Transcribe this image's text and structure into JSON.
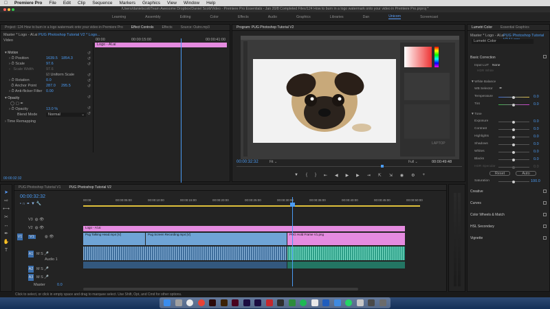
{
  "menubar": {
    "apple": "",
    "items": [
      "Premiere Pro",
      "File",
      "Edit",
      "Clip",
      "Sequence",
      "Markers",
      "Graphics",
      "View",
      "Window",
      "Help"
    ]
  },
  "titlebar": {
    "path": "/Users/danielscott/Team Awesome Dropbox/Daniel Scott/Video - Premiere Pro Essentials - Jan 20/8 Completed Files/124 How to burn in a logo watermark onto your video in Premiere Pro.prproj *"
  },
  "workspaces": {
    "items": [
      "Learning",
      "Assembly",
      "Editing",
      "Color",
      "Effects",
      "Audio",
      "Graphics",
      "Libraries",
      "Dan",
      "Unicorn",
      "Screencast"
    ],
    "active": "Unicorn"
  },
  "project_panel": {
    "title": "Project: 124 How to burn in a logo watermark onto your video in Premiere Pro"
  },
  "effect_controls": {
    "tabs": [
      "Effect Controls",
      "Effects",
      "Source: Outro.mp3"
    ],
    "active_tab": "Effect Controls",
    "master": "Master * Logo - Al.ai",
    "sequence": "PUG Photoshop Tutorial V2 * Logo...",
    "section": "Video",
    "times": [
      "00:00",
      "00:00:15:00",
      "00:00:41:00"
    ],
    "clip_bar": "Logo - Al.ai",
    "motion": "Motion",
    "props": [
      {
        "name": "Position",
        "v1": "1639.5",
        "v2": "1854.3"
      },
      {
        "name": "Scale",
        "v1": "97.6",
        "v2": ""
      },
      {
        "name": "Scale Width",
        "v1": "97.6",
        "v2": ""
      },
      {
        "name": "",
        "v1": "Uniform Scale",
        "v2": ""
      },
      {
        "name": "Rotation",
        "v1": "0.0",
        "v2": ""
      },
      {
        "name": "Anchor Point",
        "v1": "287.0",
        "v2": "295.5"
      },
      {
        "name": "Anti-flicker Filter",
        "v1": "0.00",
        "v2": ""
      }
    ],
    "opacity": "Opacity",
    "opacity_value": "13.0 %",
    "opacity_label": "Opacity",
    "blend_label": "Blend Mode",
    "blend_value": "Normal",
    "time_remap": "Time Remapping",
    "timecode": "00:00:32:32"
  },
  "program": {
    "title": "Program: PUG Photoshop Tutorial V2",
    "timecode": "00:00:32:32",
    "fit": "Fit",
    "quality": "Full",
    "duration": "00:00:49:48",
    "watermark": "LAPTOP"
  },
  "lumetri": {
    "tabs": [
      "Lumetri Color",
      "Essential Graphics"
    ],
    "master": "Master * Logo - Al.ai",
    "sequence": "PUG Photoshop Tutorial V2 * Logo...",
    "lumetri_label": "Lumetri Color",
    "basic": "Basic Correction",
    "input_lut": "Input LUT",
    "input_lut_value": "None",
    "hdr_white": "HDR White",
    "white_balance": "White Balance",
    "wb_selector": "WB Selector",
    "temperature": "Temperature",
    "temperature_val": "0.0",
    "tint": "Tint",
    "tint_val": "0.0",
    "tone": "Tone",
    "tone_items": [
      {
        "name": "Exposure",
        "val": "0.0"
      },
      {
        "name": "Contrast",
        "val": "0.0"
      },
      {
        "name": "Highlights",
        "val": "0.0"
      },
      {
        "name": "Shadows",
        "val": "0.0"
      },
      {
        "name": "Whites",
        "val": "0.0"
      },
      {
        "name": "Blacks",
        "val": "0.0"
      },
      {
        "name": "HDR Specular",
        "val": "0.0"
      }
    ],
    "reset": "Reset",
    "auto": "Auto",
    "saturation": "Saturation",
    "saturation_val": "100.0",
    "sections": [
      "Creative",
      "Curves",
      "Color Wheels & Match",
      "HSL Secondary",
      "Vignette"
    ]
  },
  "timeline": {
    "tabs": [
      "PUG Photoshop Tutorial V1",
      "PUG Photoshop Tutorial V2"
    ],
    "active_tab": "PUG Photoshop Tutorial V2",
    "timecode": "00:00:32:32",
    "ruler": [
      "00:00",
      "00:00:05:00",
      "00:00:10:00",
      "00:00:15:00",
      "00:00:20:00",
      "00:00:25:00",
      "00:00:30:00",
      "00:00:35:00",
      "00:00:40:00",
      "00:00:45:00",
      "00:00:50:00"
    ],
    "tracks": [
      "V3",
      "V2",
      "V1",
      "A1",
      "A2",
      "A3"
    ],
    "audio_label": "Audio 1",
    "master": "Master",
    "master_val": "0.0",
    "clips": {
      "logo": "Logo - Al.ai",
      "v1a": "Pug Talking Head.mp4 [V]",
      "v1b": "Pug Screen Recording.mp4 [V]",
      "v1c": "PUG Hold Frame V1.png"
    }
  },
  "statusbar": "Click to select, or click in empty space and drag to marquee select. Use Shift, Opt, and Cmd for other options.",
  "colors": {
    "accent": "#4b9cf5",
    "logo_clip": "#e58be0",
    "video_clip": "#6fa4d6",
    "audio_clip": "#2d9e87"
  }
}
